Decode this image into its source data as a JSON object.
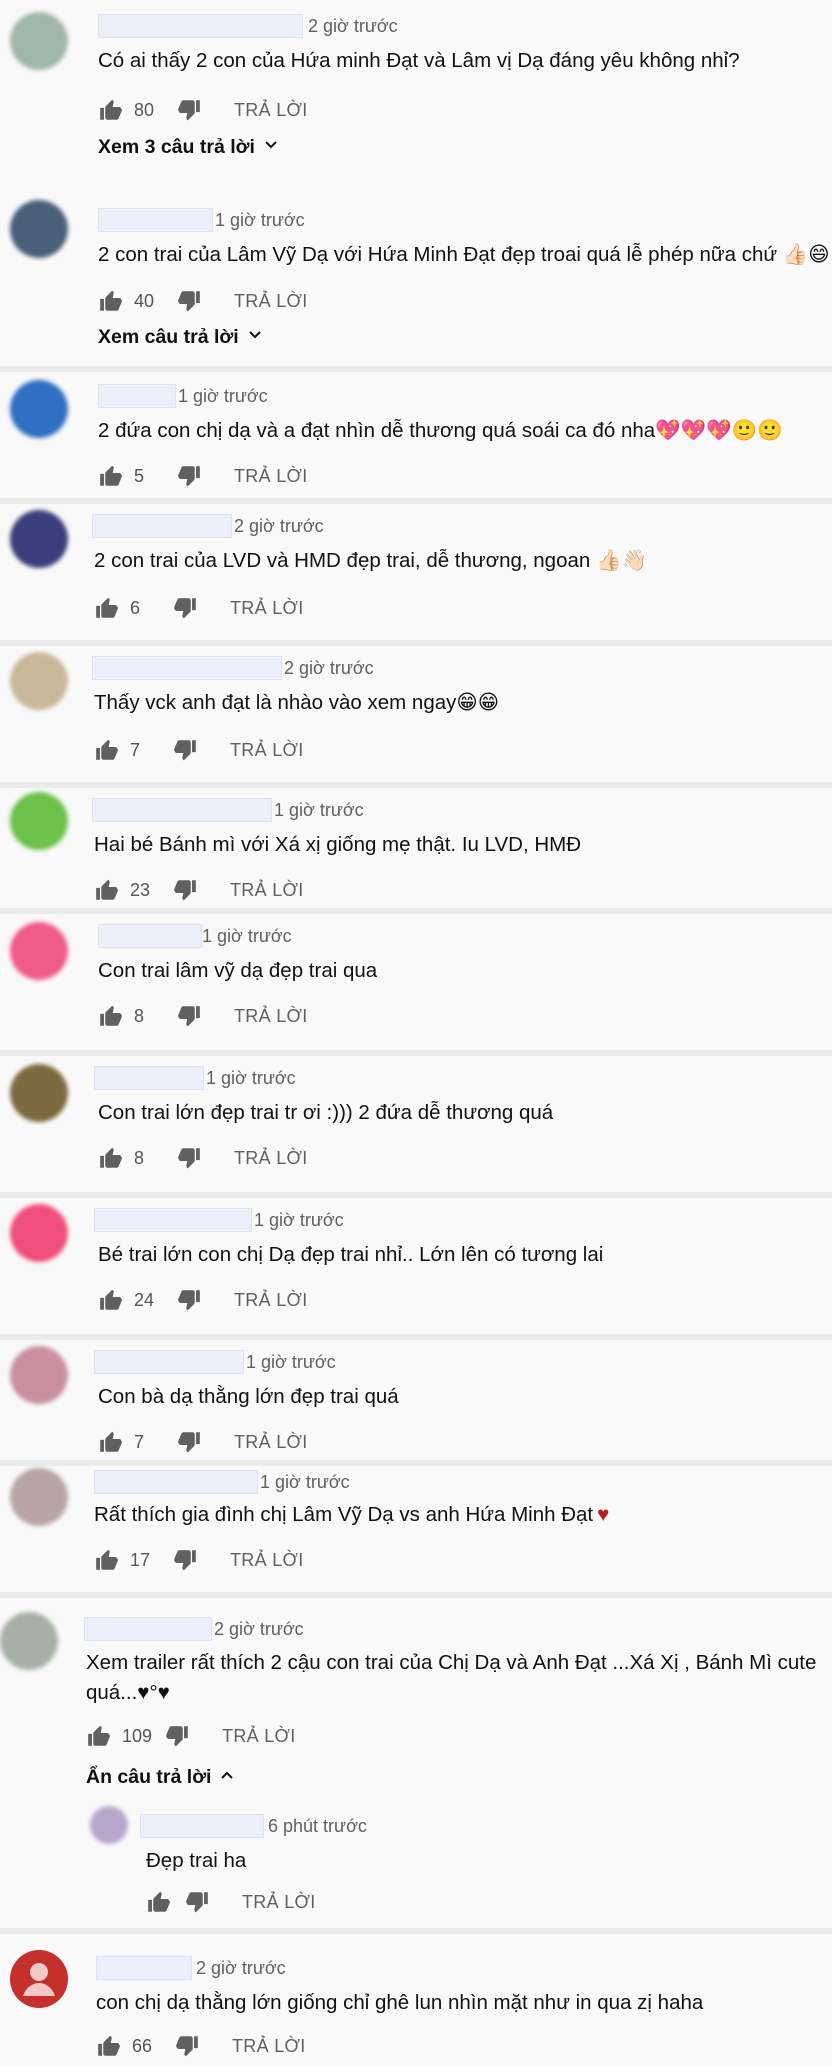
{
  "reply_label": "TRẢ LỜI",
  "comments": [
    {
      "time": "2 giờ trước",
      "text": "Có ai thấy 2 con của Hứa minh Đạt và Lâm vị Dạ đáng yêu không nhỉ?",
      "likes": "80",
      "toggle": "Xem 3 câu trả lời"
    },
    {
      "time": "1 giờ trước",
      "text": "2 con trai của Lâm Vỹ Dạ với Hứa Minh Đạt đẹp troai quá lễ phép nữa chứ 👍🏻😄",
      "likes": "40",
      "toggle": "Xem câu trả lời"
    },
    {
      "time": "1 giờ trước",
      "text": "2 đứa con chị dạ và a đạt nhìn dễ thương quá soái ca đó nha💖💖💖🙂🙂",
      "likes": "5"
    },
    {
      "time": "2 giờ trước",
      "text": "2 con trai của LVD và HMD đẹp trai, dễ thương, ngoan 👍🏻👋🏻",
      "likes": "6"
    },
    {
      "time": "2 giờ trước",
      "text": "Thấy vck anh đạt là nhào vào xem ngay😁😁",
      "likes": "7"
    },
    {
      "time": "1 giờ trước",
      "text": "Hai bé Bánh mì với Xá xị giống mẹ thật. Iu LVD, HMĐ",
      "likes": "23"
    },
    {
      "time": "1 giờ trước",
      "text": "Con trai lâm vỹ dạ đẹp trai qua",
      "likes": "8"
    },
    {
      "time": "1 giờ trước",
      "text": "Con trai lớn đẹp trai tr ơi :))) 2 đứa dễ thương quá",
      "likes": "8"
    },
    {
      "time": "1 giờ trước",
      "text": "Bé trai lớn con chị Dạ đẹp trai nhỉ.. Lớn lên có tương lai",
      "likes": "24"
    },
    {
      "time": "1 giờ trước",
      "text": "Con bà dạ thằng lớn đẹp trai quá",
      "likes": "7"
    },
    {
      "time": "1 giờ trước",
      "text": "Rất thích gia đình chị Lâm Vỹ Dạ vs anh Hứa Minh Đạt",
      "heart": "♥",
      "likes": "17"
    },
    {
      "time": "2 giờ trước",
      "text": "Xem trailer rất thích 2 cậu con trai của Chị Dạ và Anh Đạt ...Xá Xị , Bánh Mì cute quá...♥°♥",
      "likes": "109",
      "toggle": "Ẩn câu trả lời"
    },
    {
      "time": "6 phút trước",
      "text": "Đẹp trai ha",
      "likes": ""
    },
    {
      "time": "2 giờ trước",
      "text": "con chị dạ thằng lớn giống chỉ ghê lun nhìn mặt như in qua zị haha",
      "likes": "66"
    }
  ],
  "colors": {
    "avatars": [
      "#9fb7a8",
      "#4a5f7a",
      "#2f6fc4",
      "#3a3f7c",
      "#c9b79a",
      "#6cc24a",
      "#ef5b8a",
      "#7c6a3e",
      "#ef4f7a",
      "#c98fa0",
      "#b9a4a4",
      "#a7b0a6",
      "#b7a6c9",
      "#c4302b"
    ],
    "meta": "#606060",
    "separator": "#ececec"
  },
  "icons": [
    "thumbs-up-icon",
    "thumbs-down-icon",
    "chevron-down-icon",
    "chevron-up-icon",
    "default-avatar-icon"
  ]
}
